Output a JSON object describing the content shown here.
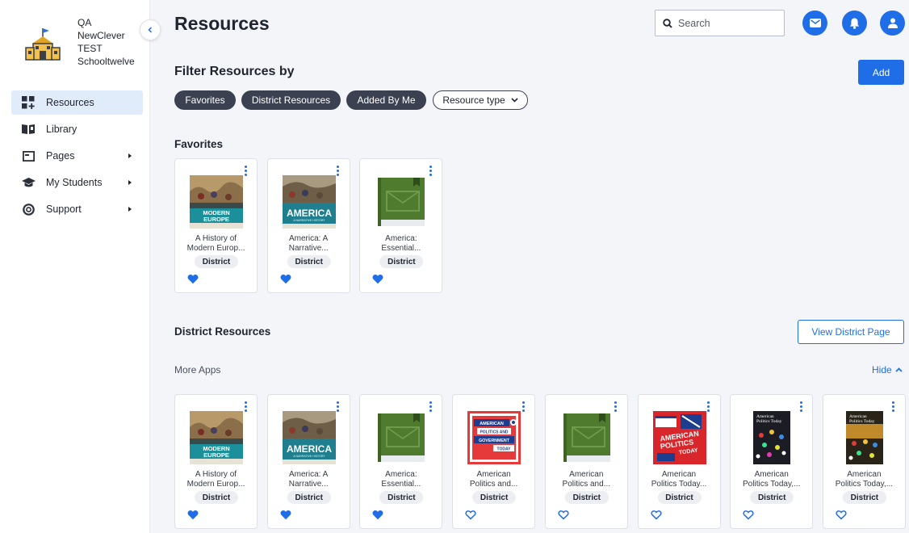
{
  "school": {
    "line1": "QA",
    "line2": "NewClever",
    "line3": "TEST",
    "line4": "Schooltwelve"
  },
  "nav": [
    {
      "label": "Resources",
      "active": true,
      "has_submenu": false
    },
    {
      "label": "Library",
      "active": false,
      "has_submenu": false
    },
    {
      "label": "Pages",
      "active": false,
      "has_submenu": true
    },
    {
      "label": "My Students",
      "active": false,
      "has_submenu": true
    },
    {
      "label": "Support",
      "active": false,
      "has_submenu": true
    }
  ],
  "header": {
    "title": "Resources",
    "search_placeholder": "Search"
  },
  "filters": {
    "title": "Filter Resources by",
    "add_label": "Add",
    "chips": [
      "Favorites",
      "District Resources",
      "Added By Me"
    ],
    "dropdown_label": "Resource type"
  },
  "favorites": {
    "title": "Favorites",
    "cards": [
      {
        "title1": "A History of",
        "title2": "Modern Europ...",
        "badge": "District",
        "favorited": true,
        "cover": "modern-europe"
      },
      {
        "title1": "America: A",
        "title2": "Narrative...",
        "badge": "District",
        "favorited": true,
        "cover": "america"
      },
      {
        "title1": "America:",
        "title2": "Essential...",
        "badge": "District",
        "favorited": true,
        "cover": "green-book"
      }
    ]
  },
  "district": {
    "title": "District Resources",
    "view_button": "View District Page",
    "more_apps": "More Apps",
    "hide_label": "Hide",
    "cards": [
      {
        "title1": "A History of",
        "title2": "Modern Europ...",
        "badge": "District",
        "favorited": true,
        "cover": "modern-europe"
      },
      {
        "title1": "America: A",
        "title2": "Narrative...",
        "badge": "District",
        "favorited": true,
        "cover": "america"
      },
      {
        "title1": "America:",
        "title2": "Essential...",
        "badge": "District",
        "favorited": true,
        "cover": "green-book"
      },
      {
        "title1": "American",
        "title2": "Politics and...",
        "badge": "District",
        "favorited": false,
        "cover": "politics-red"
      },
      {
        "title1": "American",
        "title2": "Politics and...",
        "badge": "District",
        "favorited": false,
        "cover": "green-book"
      },
      {
        "title1": "American",
        "title2": "Politics Today...",
        "badge": "District",
        "favorited": false,
        "cover": "politics-today-red"
      },
      {
        "title1": "American",
        "title2": "Politics Today,...",
        "badge": "District",
        "favorited": false,
        "cover": "politics-today-dark"
      },
      {
        "title1": "American",
        "title2": "Politics Today,...",
        "badge": "District",
        "favorited": false,
        "cover": "politics-today-dark2"
      }
    ]
  },
  "cover_art": {
    "modern-europe": {
      "line1": "MODERN",
      "line2": "EUROPE"
    },
    "america": {
      "line1": "AMERICA",
      "line2": "A NARRATIVE HISTORY"
    },
    "politics-red": {
      "line1": "AMERICAN",
      "line2": "POLITICS AND",
      "line3": "GOVERNMENT",
      "line4": "TODAY"
    },
    "politics-today-red": {
      "line1": "AMERICAN",
      "line2": "POLITICS",
      "line3": "TODAY"
    },
    "politics-today-dark": {
      "line1": "American",
      "line2": "Politics Today"
    },
    "politics-today-dark2": {
      "line1": "American",
      "line2": "Politics Today"
    }
  },
  "colors": {
    "accent": "#1f6ee8",
    "chip_dark": "#3b4150",
    "active_nav": "#e1ecfb",
    "page_bg": "#f4f5f8"
  }
}
